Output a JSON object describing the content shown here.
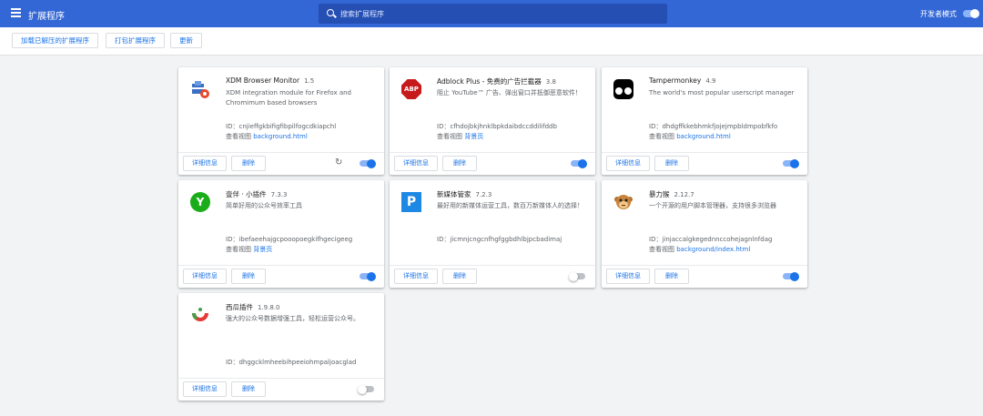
{
  "header": {
    "title": "扩展程序",
    "search_placeholder": "搜索扩展程序",
    "dev_mode_label": "开发者模式",
    "dev_mode_on": true
  },
  "toolbar": {
    "load_unpacked": "加载已解压的扩展程序",
    "pack": "打包扩展程序",
    "update": "更新"
  },
  "card_labels": {
    "details": "详细信息",
    "remove": "删除",
    "id_prefix": "ID：",
    "views_prefix": "查看视图"
  },
  "extensions": [
    {
      "name": "XDM Browser Monitor",
      "version": "1.5",
      "description": "XDM integration module for Firefox and Chromimum based browsers",
      "id": "cnjieffgkbifigfibpilfogcdkiapchl",
      "view": "background.html",
      "enabled": true,
      "icon": "xdm-monitor-icon"
    },
    {
      "name": "Adblock Plus - 免费的广告拦截器",
      "version": "3.8",
      "description": "阻止 YouTube™ 广告、弹出窗口并抵御恶意软件！",
      "id": "cfhdojbkjhnklbpkdaibdccddilifddb",
      "view": "背景页",
      "enabled": true,
      "icon": "abp-icon"
    },
    {
      "name": "Tampermonkey",
      "version": "4.9",
      "description": "The world's most popular userscript manager",
      "id": "dhdgffkkebhmkfjojejmpbldmpobfkfo",
      "view": "background.html",
      "enabled": true,
      "icon": "tampermonkey-icon"
    },
    {
      "name": "壹伴 · 小插件",
      "version": "7.3.3",
      "description": "简单好用的公众号效率工具",
      "id": "ibefaeehajgcpooopoegkifhgecigeeg",
      "view": "背景页",
      "enabled": true,
      "icon": "yiban-icon"
    },
    {
      "name": "新媒体管家",
      "version": "7.2.3",
      "description": "最好用的新媒体运营工具，数百万新媒体人的选择！",
      "id": "jicmnjcngcnfhgfggbdhlbjpcbadimaj",
      "view": "",
      "enabled": false,
      "icon": "xinmeiti-icon"
    },
    {
      "name": "暴力猴",
      "version": "2.12.7",
      "description": "一个开源的用户脚本管理器，支持很多浏览器",
      "id": "jinjaccalgkegednnccohejagnlnfdag",
      "view": "background/index.html",
      "enabled": true,
      "icon": "violentmonkey-icon"
    },
    {
      "name": "西瓜插件",
      "version": "1.9.8.0",
      "description": "强大的公众号数据增强工具，轻松运营公众号。",
      "id": "dhggcklmheebihpeeiohmpaljoacglad",
      "view": "",
      "enabled": false,
      "icon": "xigua-icon"
    }
  ],
  "colors": {
    "header": "#3367d6",
    "accent": "#1a73e8",
    "background": "#f1f3f4"
  }
}
